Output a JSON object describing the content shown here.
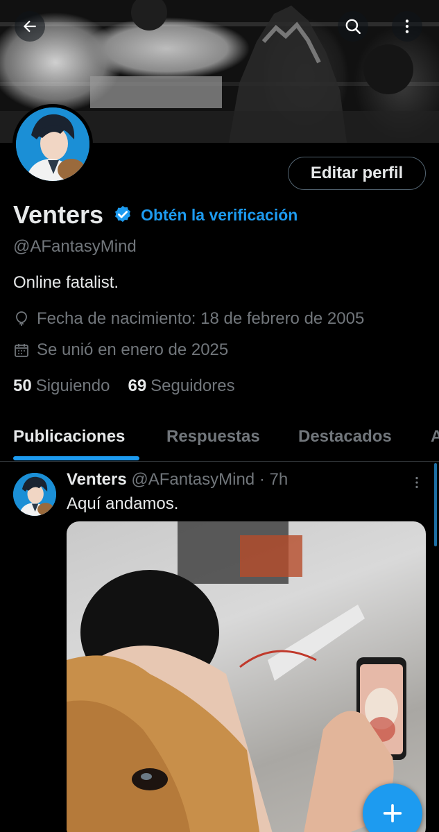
{
  "banner": {
    "back_icon": "arrow-left-icon",
    "search_icon": "search-icon",
    "more_icon": "more-vertical-icon"
  },
  "profile": {
    "edit_label": "Editar perfil",
    "display_name": "Venters",
    "verified_icon": "verified-badge-icon",
    "get_verified": "Obtén la verificación",
    "handle": "@AFantasyMind",
    "bio": "Online fatalist.",
    "birthday": "Fecha de nacimiento: 18 de febrero de 2005",
    "joined": "Se unió en enero de 2025",
    "following_count": "50",
    "following_label": "Siguiendo",
    "followers_count": "69",
    "followers_label": "Seguidores"
  },
  "tabs": [
    {
      "label": "Publicaciones",
      "active": true
    },
    {
      "label": "Respuestas",
      "active": false
    },
    {
      "label": "Destacados",
      "active": false
    },
    {
      "label": "A",
      "active": false
    }
  ],
  "post": {
    "author": "Venters",
    "meta": "@AFantasyMind · 7h",
    "text": "Aquí andamos."
  },
  "fab_icon": "plus-icon",
  "colors": {
    "accent": "#1d9bf0",
    "background": "#000000",
    "secondary_text": "#71767b"
  }
}
